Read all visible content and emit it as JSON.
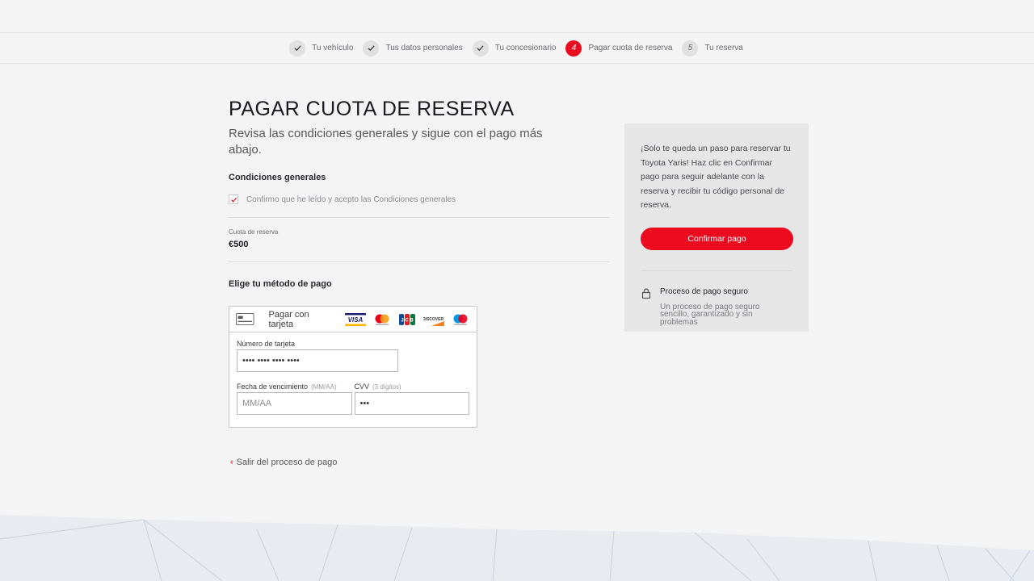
{
  "stepper": {
    "steps": [
      {
        "marker": "",
        "label": "Tu vehículo",
        "state": "done"
      },
      {
        "marker": "",
        "label": "Tus datos personales",
        "state": "done"
      },
      {
        "marker": "",
        "label": "Tu concesionario",
        "state": "done"
      },
      {
        "marker": "4",
        "label": "Pagar cuota de reserva",
        "state": "active"
      },
      {
        "marker": "5",
        "label": "Tu reserva",
        "state": "pending"
      }
    ]
  },
  "main": {
    "title": "PAGAR CUOTA DE RESERVA",
    "subtitle": "Revisa las condiciones generales y sigue con el pago más abajo.",
    "conditions_title": "Condiciones generales",
    "conditions_checkbox_label": "Confirmo que he leído y acepto las Condiciones generales",
    "conditions_checked": true,
    "fee_label": "Cuota de reserva",
    "fee_value": "€500",
    "payment_method_title": "Elige tu método de pago",
    "exit_link": "Salir del proceso de pago"
  },
  "card_form": {
    "header_label": "Pagar con tarjeta",
    "brands": [
      "visa-icon",
      "mastercard-icon",
      "jcb-icon",
      "discover-icon",
      "maestro-icon"
    ],
    "card_number_label": "Número de tarjeta",
    "card_number_value": "•••• •••• •••• ••••",
    "expiry_label": "Fecha de vencimiento",
    "expiry_hint": "(MM/AA)",
    "expiry_placeholder": "MM/AA",
    "cvv_label": "CVV",
    "cvv_hint": "(3 dígitos)",
    "cvv_value": "•••"
  },
  "side_panel": {
    "text": "¡Solo te queda un paso para reservar tu Toyota Yaris! Haz clic en Confirmar pago para seguir adelante con la reserva y recibir tu código personal de reserva.",
    "confirm_button": "Confirmar pago",
    "secure_title": "Proceso de pago seguro",
    "secure_desc": "Un proceso de pago seguro sencillo, garantizado y sin problemas"
  },
  "colors": {
    "accent": "#eb0a1e",
    "background": "#f4f4f4",
    "panel": "#e6e6e6"
  }
}
